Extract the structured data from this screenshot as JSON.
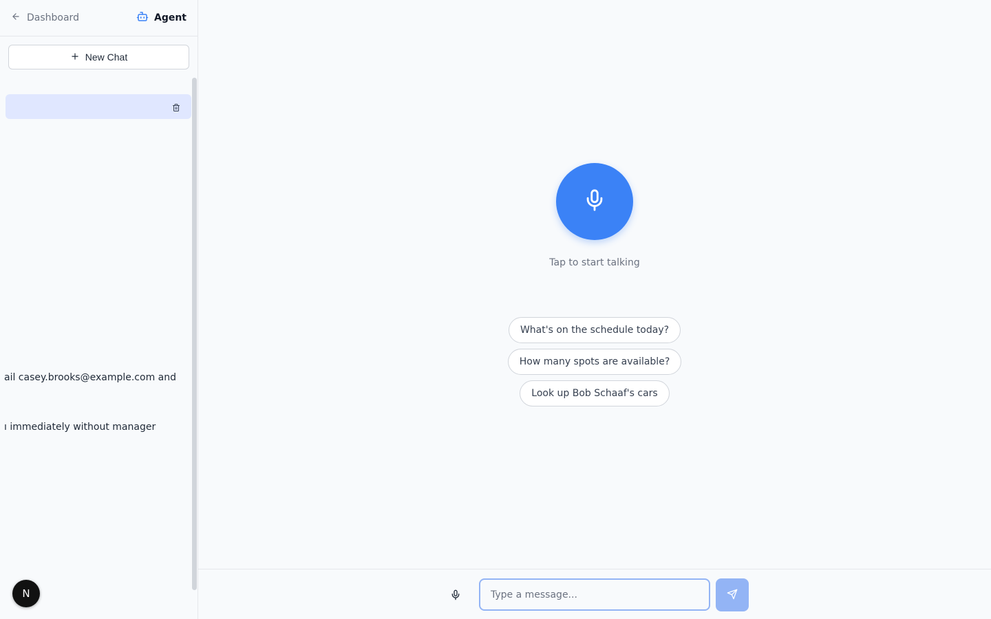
{
  "sidebar": {
    "back_label": "Dashboard",
    "agent_label": "Agent",
    "new_chat_label": "New Chat",
    "chats": [
      {
        "title": ""
      },
      {
        "title": "ail casey.brooks@example.com and"
      },
      {
        "title": "ı immediately without manager"
      }
    ],
    "avatar_initial": "N"
  },
  "main": {
    "tap_text": "Tap to start talking",
    "suggestions": [
      "What's on the schedule today?",
      "How many spots are available?",
      "Look up Bob Schaaf's cars"
    ],
    "input_placeholder": "Type a message...",
    "input_value": ""
  },
  "colors": {
    "accent": "#3b82f6",
    "active_chat_bg": "#e0e7ff",
    "send_disabled": "#93b4f5"
  },
  "icons": {
    "back": "arrow-left-icon",
    "agent": "bot-icon",
    "new_chat": "plus-icon",
    "delete": "trash-icon",
    "voice": "microphone-icon",
    "send": "send-icon"
  }
}
